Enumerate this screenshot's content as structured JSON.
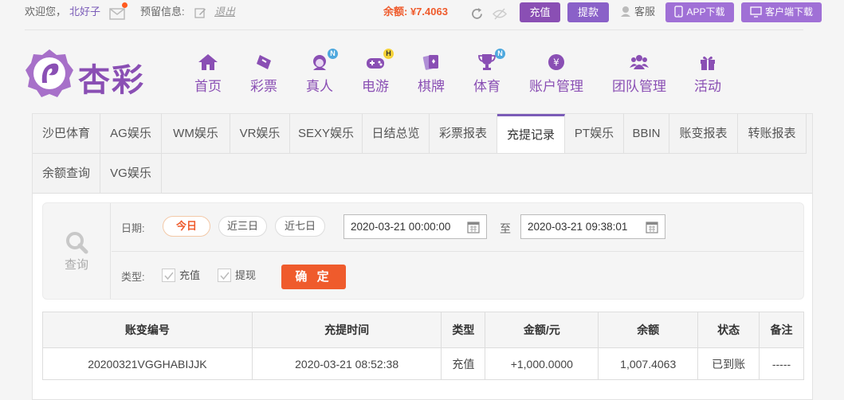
{
  "topbar": {
    "welcome_label": "欢迎您，",
    "username": "北好子",
    "reserved_label": "预留信息:",
    "logout_label": "退出",
    "balance_text": "余额: ¥7.4063",
    "recharge_button": "充值",
    "withdraw_button": "提款",
    "service_label": "客服",
    "app_download": "APP下载",
    "client_download": "客户端下载",
    "accent_color": "#8a4fb4",
    "balance_color": "#ef5b2c"
  },
  "logo": {
    "text": "杏彩"
  },
  "nav": [
    {
      "label": "首页",
      "icon": "home-icon"
    },
    {
      "label": "彩票",
      "icon": "ticket-icon"
    },
    {
      "label": "真人",
      "icon": "live-dealer-icon",
      "badge": "N"
    },
    {
      "label": "电游",
      "icon": "gamepad-icon",
      "badge": "H"
    },
    {
      "label": "棋牌",
      "icon": "cards-icon"
    },
    {
      "label": "体育",
      "icon": "trophy-icon",
      "badge": "N"
    },
    {
      "label": "账户管理",
      "icon": "account-icon"
    },
    {
      "label": "团队管理",
      "icon": "team-icon"
    },
    {
      "label": "活动",
      "icon": "gift-icon"
    }
  ],
  "tabs": [
    "沙巴体育",
    "AG娱乐",
    "WM娱乐",
    "VR娱乐",
    "SEXY娱乐",
    "日结总览",
    "彩票报表",
    "充提记录",
    "PT娱乐",
    "BBIN",
    "账变报表",
    "转账报表",
    "余额查询",
    "VG娱乐"
  ],
  "active_tab": "充提记录",
  "filter": {
    "side_label": "查询",
    "date_label": "日期:",
    "quick_dates": [
      "今日",
      "近三日",
      "近七日"
    ],
    "selected_quick": "今日",
    "start_date": "2020-03-21 00:00:00",
    "to_label": "至",
    "end_date": "2020-03-21 09:38:01",
    "type_label": "类型:",
    "types": [
      "充值",
      "提现"
    ],
    "confirm_button": "确 定"
  },
  "table": {
    "columns": [
      "账变编号",
      "充提时间",
      "类型",
      "金额/元",
      "余额",
      "状态",
      "备注"
    ],
    "rows": [
      [
        "20200321VGGHABIJJK",
        "2020-03-21 08:52:38",
        "充值",
        "+1,000.0000",
        "1,007.4063",
        "已到账",
        "-----"
      ]
    ]
  }
}
